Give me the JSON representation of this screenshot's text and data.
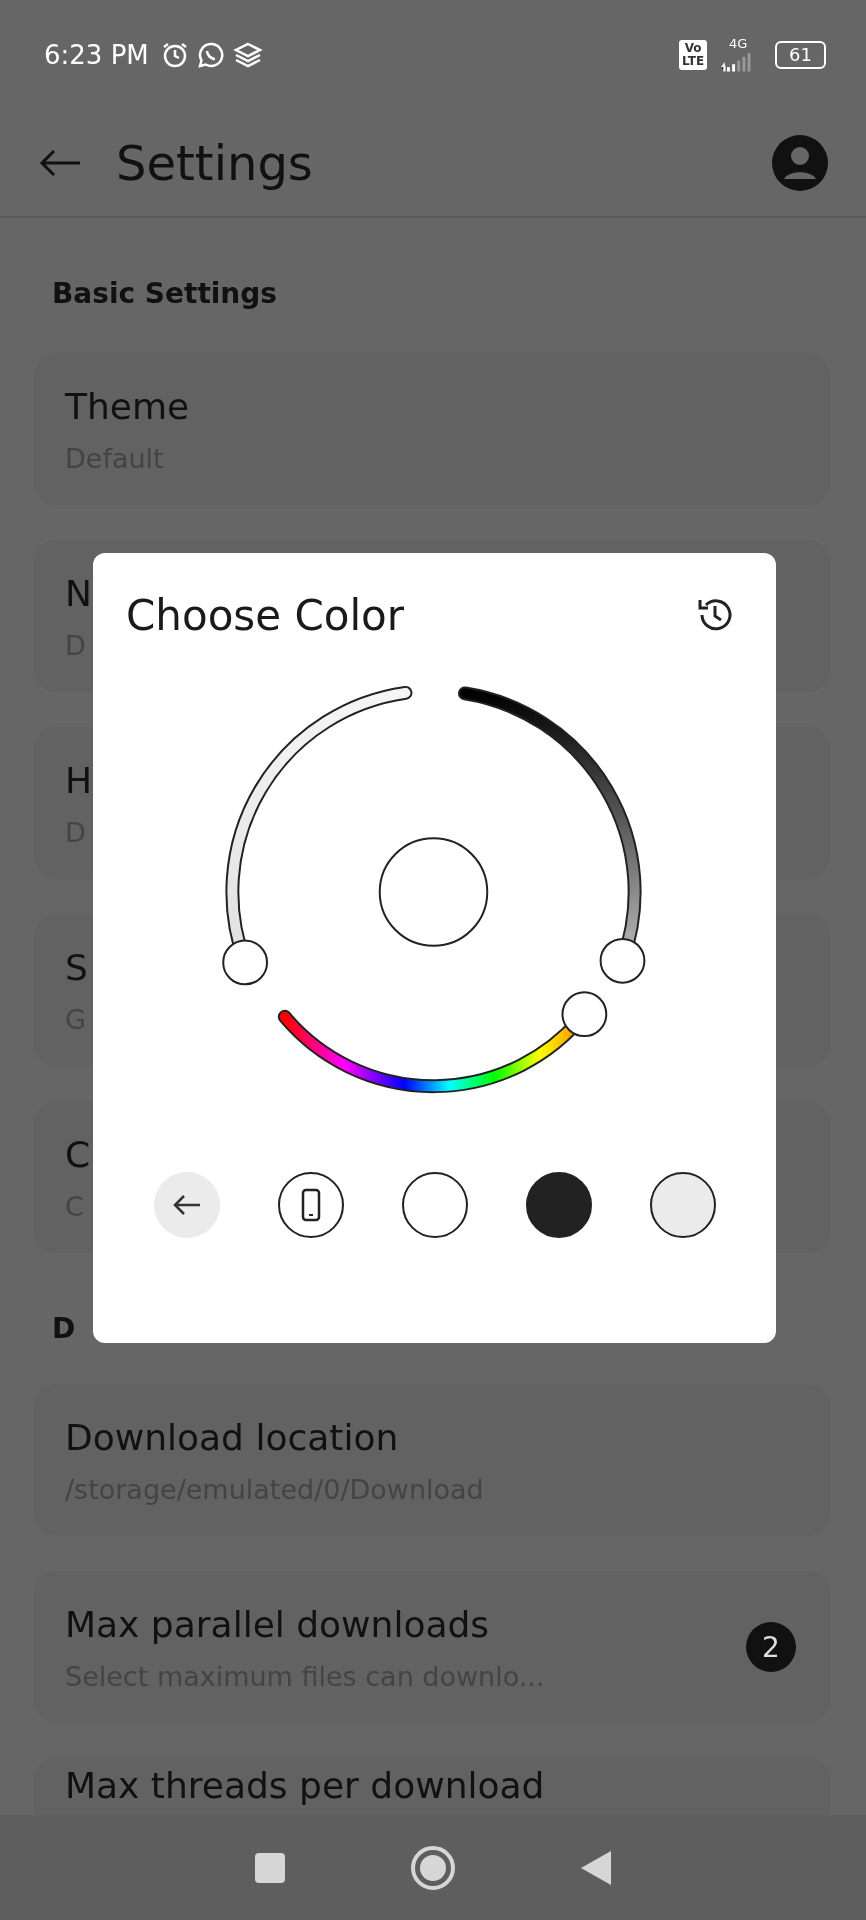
{
  "status_bar": {
    "time": "6:23 PM",
    "volte": [
      "Vo",
      "LTE"
    ],
    "network": "4G",
    "battery": "61"
  },
  "app_bar": {
    "title": "Settings"
  },
  "sections": [
    {
      "header": "Basic Settings",
      "items": [
        {
          "title": "Theme",
          "subtitle": "Default"
        },
        {
          "title": "N",
          "subtitle": "D"
        },
        {
          "title": "H",
          "subtitle": "D"
        },
        {
          "title": "S",
          "subtitle": "G"
        },
        {
          "title": "C",
          "subtitle": "C"
        }
      ]
    },
    {
      "header": "D",
      "items": [
        {
          "title": "Download location",
          "subtitle": "/storage/emulated/0/Download"
        },
        {
          "title": "Max parallel downloads",
          "subtitle": "Select maximum files can downlo...",
          "badge": "2"
        },
        {
          "title": "Max threads per download"
        }
      ]
    }
  ],
  "dialog": {
    "title": "Choose Color",
    "sliders": [
      {
        "kind": "light"
      },
      {
        "kind": "dark"
      },
      {
        "kind": "hue"
      }
    ],
    "swatches": [
      {
        "kind": "back"
      },
      {
        "kind": "device"
      },
      {
        "kind": "color",
        "color": "#ffffff"
      },
      {
        "kind": "color",
        "color": "#222222"
      },
      {
        "kind": "color",
        "color": "#ebebeb"
      }
    ]
  }
}
